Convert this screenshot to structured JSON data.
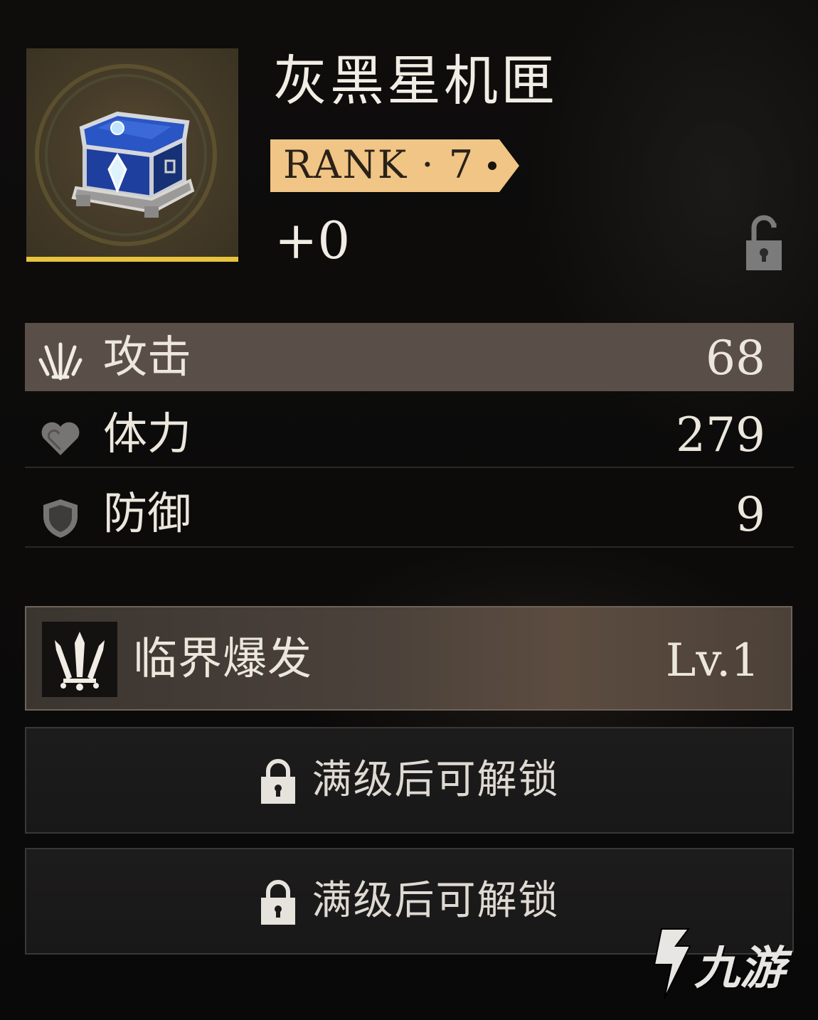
{
  "item": {
    "name": "灰黑星机匣",
    "rank_label": "RANK · 7",
    "enhance_level": "+0",
    "rarity_color": "#e8c33b",
    "icon": "blue-treasure-chest-icon",
    "locked": false
  },
  "stats": [
    {
      "label": "攻击",
      "value": "68",
      "icon": "swords-icon",
      "highlighted": true
    },
    {
      "label": "体力",
      "value": "279",
      "icon": "heart-icon",
      "highlighted": false
    },
    {
      "label": "防御",
      "value": "9",
      "icon": "shield-icon",
      "highlighted": false
    }
  ],
  "skill": {
    "name": "临界爆发",
    "level": "Lv.1",
    "icon": "swords-icon"
  },
  "locked_slots": [
    {
      "text": "满级后可解锁",
      "icon": "lock-icon"
    },
    {
      "text": "满级后可解锁",
      "icon": "lock-icon"
    }
  ],
  "watermark": {
    "text": "九游"
  }
}
